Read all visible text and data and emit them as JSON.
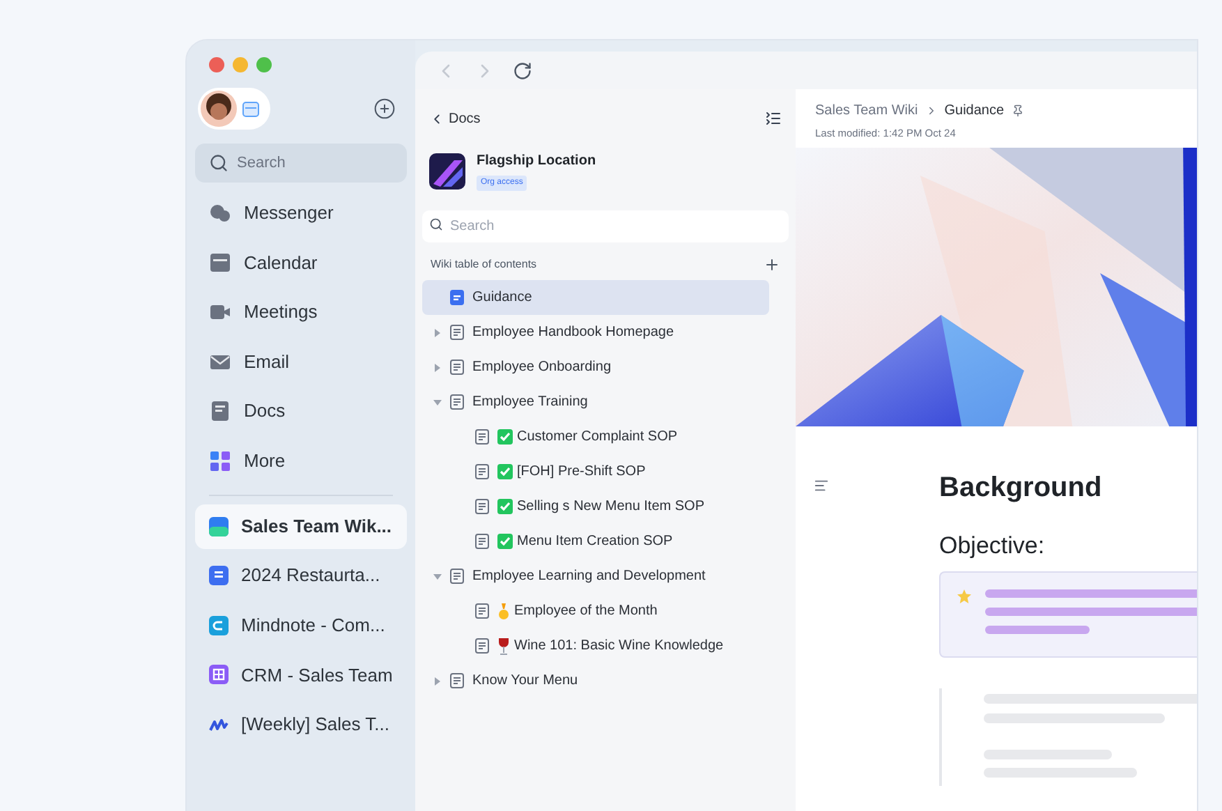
{
  "sidebar": {
    "search": {
      "placeholder": "Search"
    },
    "nav": [
      {
        "label": "Messenger",
        "kind": "messenger"
      },
      {
        "label": "Calendar",
        "kind": "calendar"
      },
      {
        "label": "Meetings",
        "kind": "meetings"
      },
      {
        "label": "Email",
        "kind": "email"
      },
      {
        "label": "Docs",
        "kind": "docs"
      },
      {
        "label": "More",
        "kind": "more"
      }
    ],
    "pinned": [
      {
        "label": "Sales Team Wik...",
        "selected": true,
        "kind": "wiki",
        "color": "#2f7df0"
      },
      {
        "label": "2024 Restaurta...",
        "selected": false,
        "kind": "doc",
        "color": "#3d6ef0"
      },
      {
        "label": "Mindnote - Com...",
        "selected": false,
        "kind": "mindnote",
        "color": "#1aa0dc"
      },
      {
        "label": "CRM - Sales Team",
        "selected": false,
        "kind": "sheet",
        "color": "#8b5cf6"
      },
      {
        "label": "[Weekly] Sales T...",
        "selected": false,
        "kind": "logo",
        "color": "#3355dd"
      }
    ]
  },
  "docs_panel": {
    "back": "Docs",
    "space": {
      "title": "Flagship Location",
      "badge": "Org access"
    },
    "search": {
      "placeholder": "Search"
    },
    "toc_label": "Wiki table of contents",
    "toc": [
      {
        "label": "Guidance",
        "selected": true
      },
      {
        "label": "Employee Handbook Homepage",
        "selected": false,
        "expanded": false
      },
      {
        "label": "Employee Onboarding",
        "selected": false,
        "expanded": false
      },
      {
        "label": "Employee Training",
        "selected": false,
        "expanded": true,
        "children": [
          {
            "label": "Customer Complaint SOP",
            "selected": false,
            "kind": "check"
          },
          {
            "label": "[FOH] Pre-Shift SOP",
            "selected": false,
            "kind": "check"
          },
          {
            "label": "Selling s New Menu Item SOP",
            "selected": false,
            "kind": "check"
          },
          {
            "label": "Menu Item Creation SOP",
            "selected": false,
            "kind": "check"
          }
        ]
      },
      {
        "label": "Employee Learning and Development",
        "selected": false,
        "expanded": true,
        "children": [
          {
            "label": "Employee of the Month",
            "selected": false,
            "kind": "medal"
          },
          {
            "label": "Wine 101: Basic Wine Knowledge",
            "selected": false,
            "kind": "wine"
          }
        ]
      },
      {
        "label": "Know Your Menu",
        "selected": false,
        "expanded": false
      }
    ]
  },
  "page": {
    "breadcrumb": [
      "Sales Team Wiki",
      "Guidance"
    ],
    "last_modified": "Last modified: 1:42 PM Oct 24",
    "heading": "Background",
    "subheading": "Objective:"
  }
}
